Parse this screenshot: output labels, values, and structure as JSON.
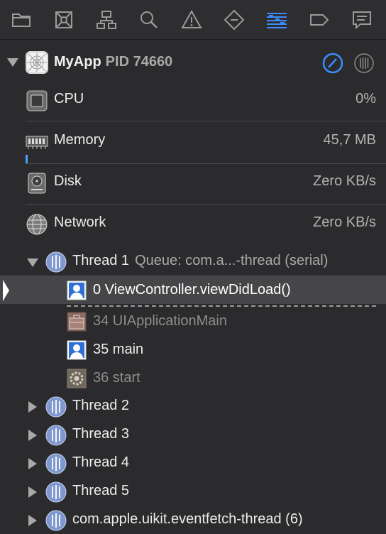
{
  "toolbar": {
    "icons": [
      "folder-icon",
      "source-control-icon",
      "symbol-navigator-icon",
      "search-icon",
      "warning-icon",
      "test-navigator-icon",
      "debug-navigator-icon",
      "breakpoint-icon",
      "report-icon"
    ],
    "active_color": "#3b8cff"
  },
  "process": {
    "name": "MyApp",
    "pid": "PID 74660"
  },
  "gauges": [
    {
      "label": "CPU",
      "value": "0%"
    },
    {
      "label": "Memory",
      "value": "45,7 MB"
    },
    {
      "label": "Disk",
      "value": "Zero KB/s"
    },
    {
      "label": "Network",
      "value": "Zero KB/s"
    }
  ],
  "memory_usage_fraction": 0.01,
  "thread1": {
    "label": "Thread 1",
    "queue": "Queue: com.a...-thread (serial)",
    "frames": [
      {
        "label": "0 ViewController.viewDidLoad()",
        "icon": "user-code-icon",
        "dim": false
      },
      {
        "label": "34 UIApplicationMain",
        "icon": "framework-icon",
        "dim": true
      },
      {
        "label": "35 main",
        "icon": "user-code-icon",
        "dim": false
      },
      {
        "label": "36 start",
        "icon": "system-gear-icon",
        "dim": true
      }
    ]
  },
  "threads": [
    {
      "label": "Thread 2"
    },
    {
      "label": "Thread 3"
    },
    {
      "label": "Thread 4"
    },
    {
      "label": "Thread 5"
    },
    {
      "label": "com.apple.uikit.eventfetch-thread (6)"
    }
  ]
}
